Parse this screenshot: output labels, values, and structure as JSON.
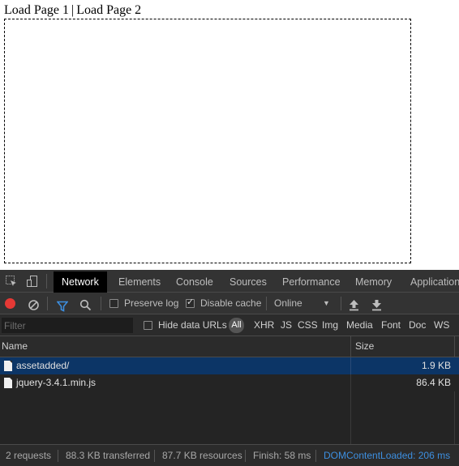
{
  "page": {
    "link1": "Load Page 1",
    "separator": "|",
    "link2": "Load Page 2"
  },
  "devtools": {
    "tabs": [
      "Network",
      "Elements",
      "Console",
      "Sources",
      "Performance",
      "Memory",
      "Application"
    ],
    "active_tab": "Network",
    "toolbar": {
      "preserve_log": "Preserve log",
      "preserve_log_checked": false,
      "disable_cache": "Disable cache",
      "disable_cache_checked": true,
      "throttling": "Online"
    },
    "filter": {
      "placeholder": "Filter",
      "hide_data_urls": "Hide data URLs",
      "hide_data_urls_checked": false,
      "types": [
        "All",
        "XHR",
        "JS",
        "CSS",
        "Img",
        "Media",
        "Font",
        "Doc",
        "WS"
      ],
      "active_type": "All"
    },
    "table": {
      "headers": {
        "name": "Name",
        "size": "Size"
      },
      "rows": [
        {
          "name": "assetadded/",
          "size": "1.9 KB",
          "selected": true
        },
        {
          "name": "jquery-3.4.1.min.js",
          "size": "86.4 KB",
          "selected": false
        }
      ]
    },
    "status": {
      "requests": "2 requests",
      "transferred": "88.3 KB transferred",
      "resources": "87.7 KB resources",
      "finish": "Finish: 58 ms",
      "dom_content_loaded": "DOMContentLoaded: 206 ms"
    },
    "colors": {
      "background": "#242424",
      "selected_row": "#0c3566",
      "record_red": "#e53935",
      "filter_blue": "#3d8fe0",
      "dcl_blue": "#3d8fe0"
    }
  }
}
